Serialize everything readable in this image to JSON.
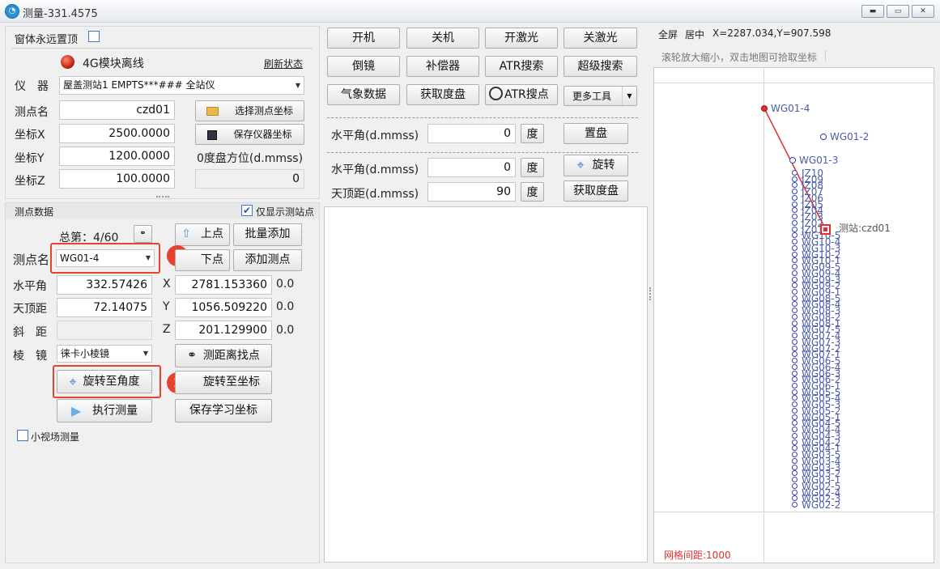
{
  "window": {
    "title": "测量-331.4575",
    "app_icon": "app-logo-icon"
  },
  "left": {
    "always_on_top_label": "窗体永远置顶",
    "status_label": "4G模块离线",
    "refresh_label": "刷新状态",
    "instrument_label": "仪　器",
    "instrument_value": "屋盖测站1 EMPTS***### 全站仪",
    "station_name_label": "测点名",
    "station_name_value": "czd01",
    "x_label": "坐标X",
    "x_value": "2500.0000",
    "y_label": "坐标Y",
    "y_value": "1200.0000",
    "z_label": "坐标Z",
    "z_value": "100.0000",
    "select_station_btn": "选择测点坐标",
    "save_instrument_btn": "保存仪器坐标",
    "zero_azimuth_label": "0度盘方位(d.mmss)",
    "zero_azimuth_value": "0",
    "points_section_label": "测点数据",
    "only_show_station_label": "仅显示测站点",
    "total_label": "总第：4/60",
    "prev_btn": "上点",
    "batch_add_btn": "批量添加",
    "point_name_label": "测点名",
    "point_name_value": "WG01-4",
    "next_btn": "下点",
    "add_point_btn": "添加测点",
    "hz_label": "水平角",
    "hz_value": "332.57426",
    "zenith_label": "天顶距",
    "zenith_value": "72.14075",
    "slope_label": "斜　距",
    "slope_value": "",
    "px_label": "X",
    "px_value": "2781.153360",
    "px_dev": "0.0",
    "py_label": "Y",
    "py_value": "1056.509220",
    "py_dev": "0.0",
    "pz_label": "Z",
    "pz_value": "201.129900",
    "pz_dev": "0.0",
    "prism_label": "棱　镜",
    "prism_value": "徕卡小棱镜",
    "find_point_btn": "测距离找点",
    "rotate_angle_btn": "旋转至角度",
    "rotate_coord_btn": "旋转至坐标",
    "execute_btn": "执行测量",
    "save_learn_btn": "保存学习坐标",
    "small_fov_label": "小视场测量",
    "badge1": "1",
    "badge2": "2"
  },
  "middle": {
    "row1": [
      "开机",
      "关机",
      "开激光",
      "关激光"
    ],
    "row2": [
      "倒镜",
      "补偿器",
      "ATR搜索",
      "超级搜索"
    ],
    "row3_a": "气象数据",
    "row3_b": "获取度盘",
    "row3_c": "ATR搜点",
    "row3_d": "更多工具",
    "hz1_label": "水平角(d.mmss)",
    "hz1_value": "0",
    "deg1": "度",
    "set_disk_btn": "置盘",
    "hz2_label": "水平角(d.mmss)",
    "hz2_value": "0",
    "deg2": "度",
    "rotate_btn": "旋转",
    "zd_label": "天顶距(d.mmss)",
    "zd_value": "90",
    "deg3": "度",
    "get_disk_btn": "获取度盘"
  },
  "right": {
    "fullscreen": "全屏",
    "center": "居中",
    "coords": "X=2287.034,Y=907.598",
    "hint": "滚轮放大缩小，双击地图可拾取坐标",
    "grid_label": "网格间距:1000",
    "station_label": "测站:czd01",
    "points": [
      "WG01-4",
      "WG01-2",
      "WG01-3"
    ],
    "stack_labels": [
      "JZ10",
      "JZ09",
      "JZ08",
      "JZ07",
      "JZ06",
      "JZ05",
      "JZ04",
      "JZ03",
      "JZ02",
      "JZ01",
      "WG10-5",
      "WG10-4",
      "WG10-3",
      "WG10-2",
      "WG10-1",
      "WG09-5",
      "WG09-4",
      "WG09-3",
      "WG09-2",
      "WG09-1",
      "WG08-5",
      "WG08-4",
      "WG08-3",
      "WG08-2",
      "WG08-1",
      "WG07-5",
      "WG07-4",
      "WG07-3",
      "WG07-2",
      "WG07-1",
      "WG06-5",
      "WG06-4",
      "WG06-3",
      "WG06-2",
      "WG06-1",
      "WG05-5",
      "WG05-4",
      "WG05-3",
      "WG05-2",
      "WG05-1",
      "WG04-5",
      "WG04-4",
      "WG04-3",
      "WG04-2",
      "WG04-1",
      "WG03-5",
      "WG03-4",
      "WG03-3",
      "WG03-2",
      "WG03-1",
      "WG02-5",
      "WG02-4",
      "WG02-3",
      "WG02-2"
    ],
    "colors": {
      "line": "#e03030",
      "point": "#3140b5",
      "label": "#4b5da8",
      "grid_text": "#e03030"
    }
  }
}
